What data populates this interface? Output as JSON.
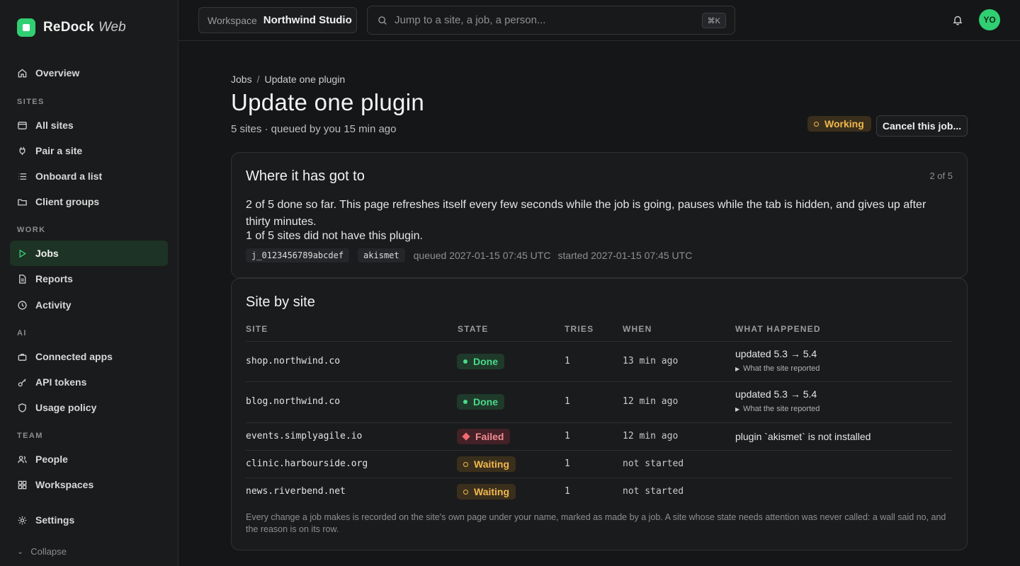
{
  "brand": {
    "name": "ReDock",
    "sub": "Web",
    "accent": "#2fcf72"
  },
  "sidebar": {
    "overview": "Overview",
    "sections": {
      "sites": "SITES",
      "work": "WORK",
      "ai": "AI",
      "team": "TEAM"
    },
    "items": {
      "all_sites": "All sites",
      "pair_site": "Pair a site",
      "onboard_list": "Onboard a list",
      "client_groups": "Client groups",
      "jobs": "Jobs",
      "reports": "Reports",
      "activity": "Activity",
      "connected_apps": "Connected apps",
      "api_tokens": "API tokens",
      "usage_policy": "Usage policy",
      "people": "People",
      "workspaces": "Workspaces",
      "settings": "Settings"
    },
    "collapse": "Collapse"
  },
  "topbar": {
    "workspace_label": "Workspace",
    "workspace_value": "Northwind Studio",
    "search_placeholder": "Jump to a site, a job, a person...",
    "search_shortcut": "⌘K",
    "avatar_initials": "YO"
  },
  "breadcrumb": {
    "root": "Jobs",
    "separator": "/",
    "current": "Update one plugin"
  },
  "job": {
    "title": "Update one plugin",
    "subtitle": "5 sites · queued by you 15 min ago",
    "status": "Working",
    "cancel_label": "Cancel this job..."
  },
  "progress_card": {
    "title": "Where it has got to",
    "counter": "2 of 5",
    "progress_text": "2 of 5 done so far. This page refreshes itself every few seconds while the job is going, pauses while the tab is hidden, and gives up after thirty minutes.",
    "missing_text": "1 of 5 sites did not have this plugin.",
    "job_id": "j_0123456789abcdef",
    "plugin": "akismet",
    "queued": "queued 2027-01-15 07:45 UTC",
    "started": "started 2027-01-15 07:45 UTC"
  },
  "site_table": {
    "title": "Site by site",
    "headers": {
      "site": "SITE",
      "state": "STATE",
      "tries": "TRIES",
      "when": "WHEN",
      "what": "WHAT HAPPENED"
    },
    "rows": [
      {
        "site": "shop.northwind.co",
        "state": "Done",
        "tries": "1",
        "when": "13 min ago",
        "what": "updated 5.3 → 5.4",
        "detail": "What the site reported"
      },
      {
        "site": "blog.northwind.co",
        "state": "Done",
        "tries": "1",
        "when": "12 min ago",
        "what": "updated 5.3 → 5.4",
        "detail": "What the site reported"
      },
      {
        "site": "events.simplyagile.io",
        "state": "Failed",
        "tries": "1",
        "when": "12 min ago",
        "what": "plugin `akismet` is not installed"
      },
      {
        "site": "clinic.harbourside.org",
        "state": "Waiting",
        "tries": "1",
        "when": "not started",
        "what": ""
      },
      {
        "site": "news.riverbend.net",
        "state": "Waiting",
        "tries": "1",
        "when": "not started",
        "what": ""
      }
    ],
    "footnote": "Every change a job makes is recorded on the site's own page under your name, marked as made by a job. A site whose state needs attention was never called: a wall said no, and the reason is on its row."
  },
  "colors": {
    "done": "#4cd88a",
    "failed": "#f28b92",
    "waiting": "#f1b84f",
    "background": "#151617"
  }
}
